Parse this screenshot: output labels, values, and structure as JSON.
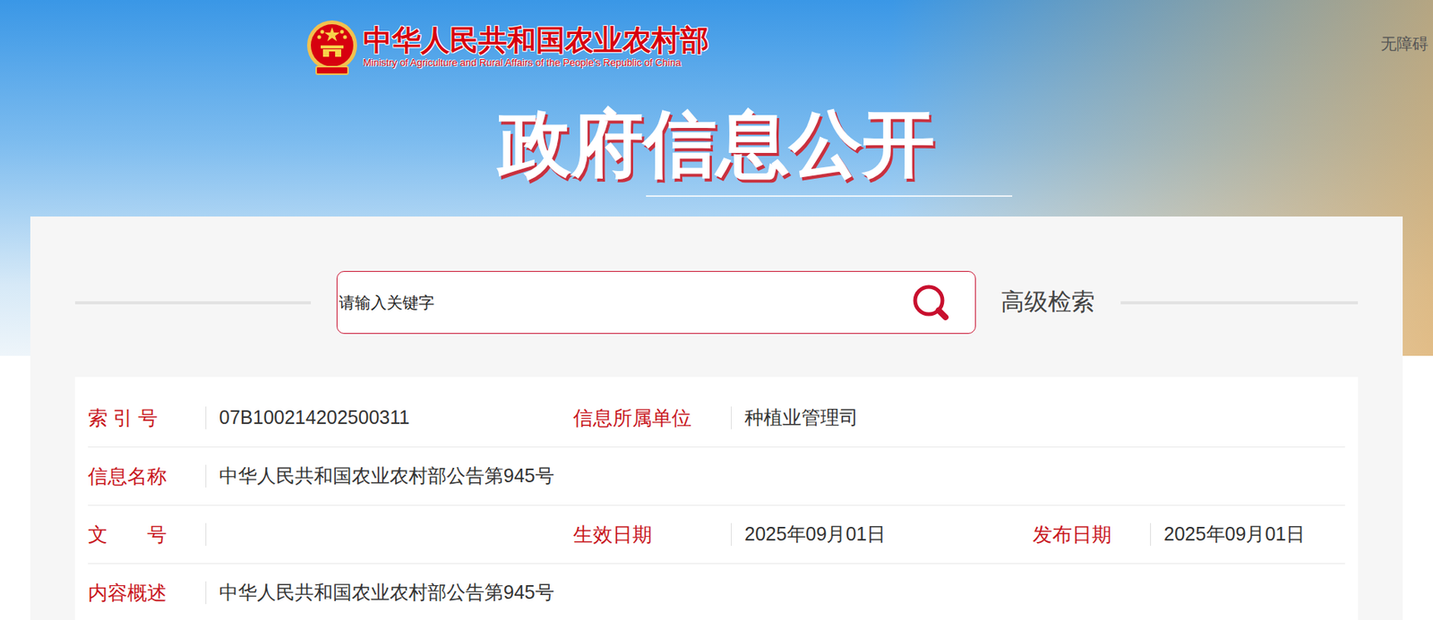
{
  "header": {
    "title": "中华人民共和国农业农村部",
    "subtitle": "Ministry of Agriculture and Rural Affairs of the People's Republic of China",
    "accessibility": "无障碍"
  },
  "banner": {
    "title": "政府信息公开"
  },
  "search": {
    "placeholder": "请输入关键字",
    "advanced": "高级检索"
  },
  "info": {
    "rows": [
      {
        "fields": [
          {
            "label": "索 引 号",
            "value": "07B100214202500311"
          },
          {
            "label": "信息所属单位",
            "value": "种植业管理司"
          }
        ]
      },
      {
        "fields": [
          {
            "label": "信息名称",
            "value": "中华人民共和国农业农村部公告第945号"
          }
        ]
      },
      {
        "fields": [
          {
            "label": "文　　号",
            "value": ""
          },
          {
            "label": "生效日期",
            "value": "2025年09月01日"
          },
          {
            "label": "发布日期",
            "value": "2025年09月01日"
          }
        ]
      },
      {
        "fields": [
          {
            "label": "内容概述",
            "value": "中华人民共和国农业农村部公告第945号"
          }
        ]
      }
    ]
  }
}
